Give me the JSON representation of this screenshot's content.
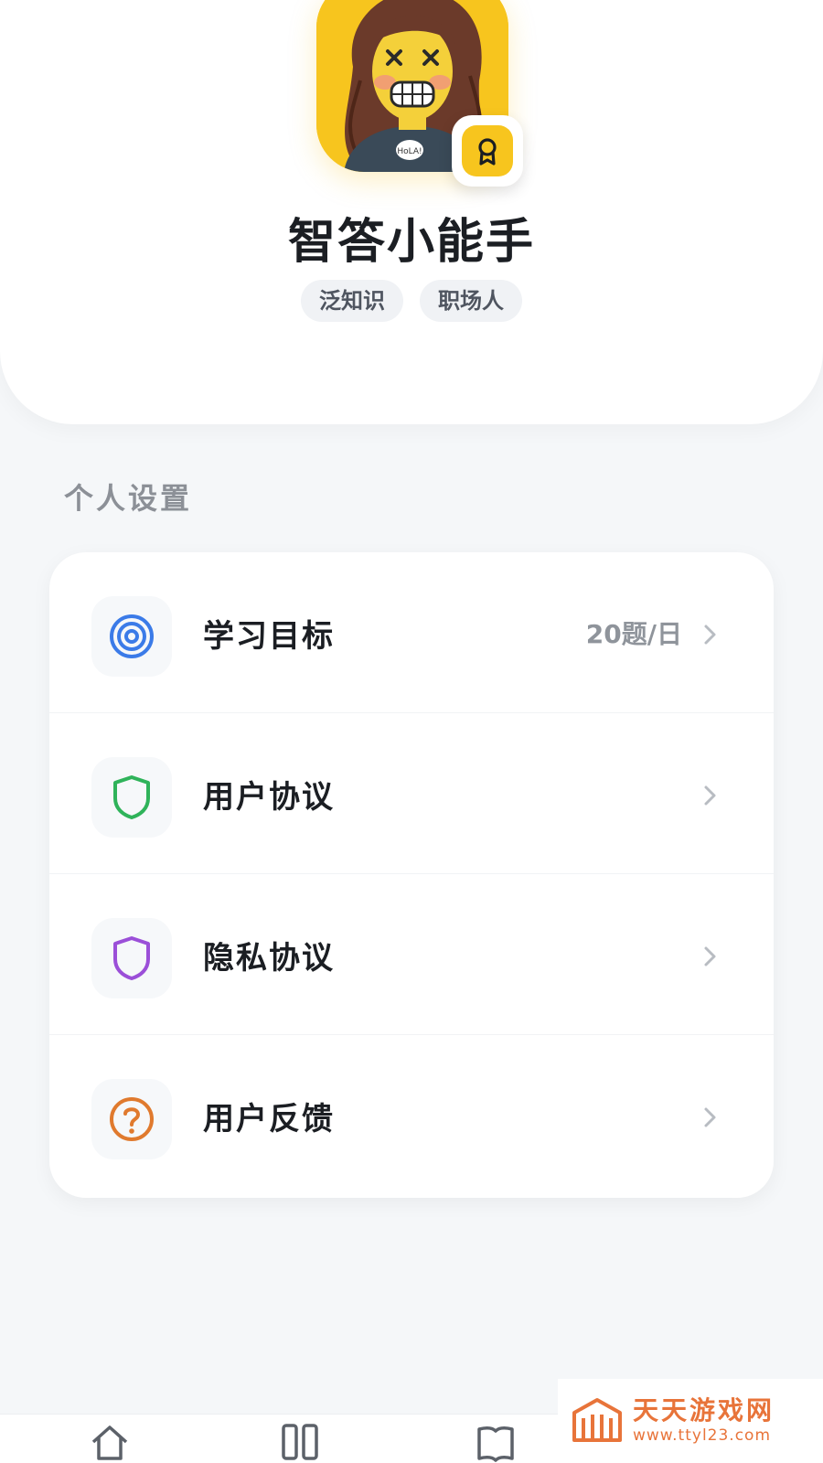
{
  "profile": {
    "username": "智答小能手",
    "tags": [
      "泛知识",
      "职场人"
    ]
  },
  "section": {
    "title": "个人设置"
  },
  "settings": [
    {
      "label": "学习目标",
      "value": "20题/日",
      "icon": "target-icon",
      "color": "#3b7be8"
    },
    {
      "label": "用户协议",
      "value": "",
      "icon": "shield-icon",
      "color": "#2fb35a"
    },
    {
      "label": "隐私协议",
      "value": "",
      "icon": "shield-icon",
      "color": "#9b4fd8"
    },
    {
      "label": "用户反馈",
      "value": "",
      "icon": "question-icon",
      "color": "#e07a2e"
    }
  ],
  "bottom_nav": {
    "items": [
      {
        "icon": "home-icon"
      },
      {
        "icon": "grid-icon"
      },
      {
        "icon": "book-icon"
      }
    ]
  },
  "watermark": {
    "title": "天天游戏网",
    "url": "www.ttyl23.com"
  },
  "colors": {
    "accent_yellow": "#f7c51e",
    "background": "#f5f7f9",
    "watermark_orange": "#e8743a"
  }
}
